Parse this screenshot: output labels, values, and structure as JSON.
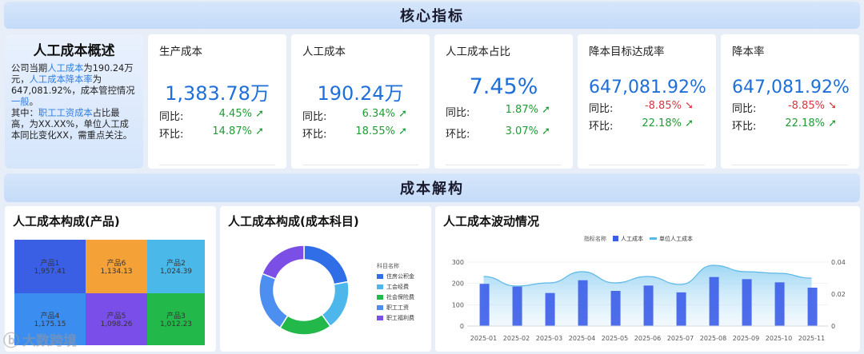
{
  "sections": {
    "core": "核心指标",
    "breakdown": "成本解构"
  },
  "overview": {
    "title": "人工成本概述",
    "p1a": "公司当期",
    "p1b": "人工成本",
    "p1c": "为190.24万元，",
    "p1d": "人工成本降本率",
    "p1e": "为647,081.92%，成本管控情况",
    "p1f": "一般",
    "p1g": "。",
    "p2a": "其中：",
    "p2b": "职工工资成本",
    "p2c": "占比最高，为XX.XX%，单位人工成本同比变化XX，需重点关注。"
  },
  "kpis": [
    {
      "title": "生产成本",
      "value": "1,383.78万",
      "yoy_label": "同比:",
      "yoy": "4.45%",
      "yoy_dir": "up",
      "mom_label": "环比:",
      "mom": "14.87%",
      "mom_dir": "up"
    },
    {
      "title": "人工成本",
      "value": "190.24万",
      "yoy_label": "同比:",
      "yoy": "6.34%",
      "yoy_dir": "up",
      "mom_label": "环比:",
      "mom": "18.55%",
      "mom_dir": "up"
    },
    {
      "title": "人工成本占比",
      "value": "7.45%",
      "yoy_label": "同比:",
      "yoy": "1.87%",
      "yoy_dir": "up",
      "mom_label": "环比:",
      "mom": "3.07%",
      "mom_dir": "up"
    },
    {
      "title": "降本目标达成率",
      "value": "647,081.92%",
      "yoy_label": "同比:",
      "yoy": "-8.85%",
      "yoy_dir": "down",
      "mom_label": "环比:",
      "mom": "22.18%",
      "mom_dir": "up"
    },
    {
      "title": "降本率",
      "value": "647,081.92%",
      "yoy_label": "同比:",
      "yoy": "-8.85%",
      "yoy_dir": "down",
      "mom_label": "环比:",
      "mom": "22.18%",
      "mom_dir": "up"
    }
  ],
  "treemap": {
    "title": "人工成本构成(产品)",
    "cells": [
      {
        "name": "产品1",
        "value": "1,957.41",
        "color": "#3a5fe5"
      },
      {
        "name": "产品6",
        "value": "1,134.13",
        "color": "#f4a237"
      },
      {
        "name": "产品2",
        "value": "1,024.39",
        "color": "#4bb8ea"
      },
      {
        "name": "产品4",
        "value": "1,175.15",
        "color": "#3b8ef0"
      },
      {
        "name": "产品5",
        "value": "1,098.26",
        "color": "#7a4ee8"
      },
      {
        "name": "产品3",
        "value": "1,012.23",
        "color": "#22b84a"
      }
    ]
  },
  "donut": {
    "title": "人工成本构成(成本科目)",
    "legend_title": "科目名称",
    "items": [
      {
        "name": "住房公积金",
        "share": 0.22,
        "color": "#2f6ee6"
      },
      {
        "name": "工会经费",
        "share": 0.18,
        "color": "#4db7ec"
      },
      {
        "name": "社会保险费",
        "share": 0.19,
        "color": "#22b84a"
      },
      {
        "name": "职工工资",
        "share": 0.22,
        "color": "#4d8ff0"
      },
      {
        "name": "职工福利费",
        "share": 0.19,
        "color": "#7b4fe6"
      }
    ]
  },
  "chart_data": {
    "type": "bar",
    "title": "人工成本波动情况",
    "legend_title": "指标名称",
    "categories": [
      "2025-01",
      "2025-02",
      "2025-03",
      "2025-04",
      "2025-05",
      "2025-06",
      "2025-07",
      "2025-08",
      "2025-09",
      "2025-10",
      "2025-11"
    ],
    "series": [
      {
        "name": "人工成本",
        "type": "bar",
        "axis": "left",
        "color": "#3b5de8",
        "values": [
          198,
          185,
          155,
          215,
          165,
          190,
          158,
          230,
          220,
          205,
          180
        ]
      },
      {
        "name": "单位人工成本",
        "type": "area",
        "axis": "right",
        "color": "#5ab8e8",
        "values": [
          0.031,
          0.025,
          0.027,
          0.034,
          0.027,
          0.031,
          0.026,
          0.038,
          0.034,
          0.033,
          0.03
        ]
      }
    ],
    "ylim_left": [
      0,
      300
    ],
    "ylim_right": [
      0,
      0.04
    ],
    "yticks_left": [
      "300",
      "200",
      "100",
      "0"
    ],
    "yticks_right": [
      "0.04",
      "0.02",
      "0"
    ],
    "grid": true,
    "legend_position": "top"
  },
  "watermark": "大数跨境"
}
